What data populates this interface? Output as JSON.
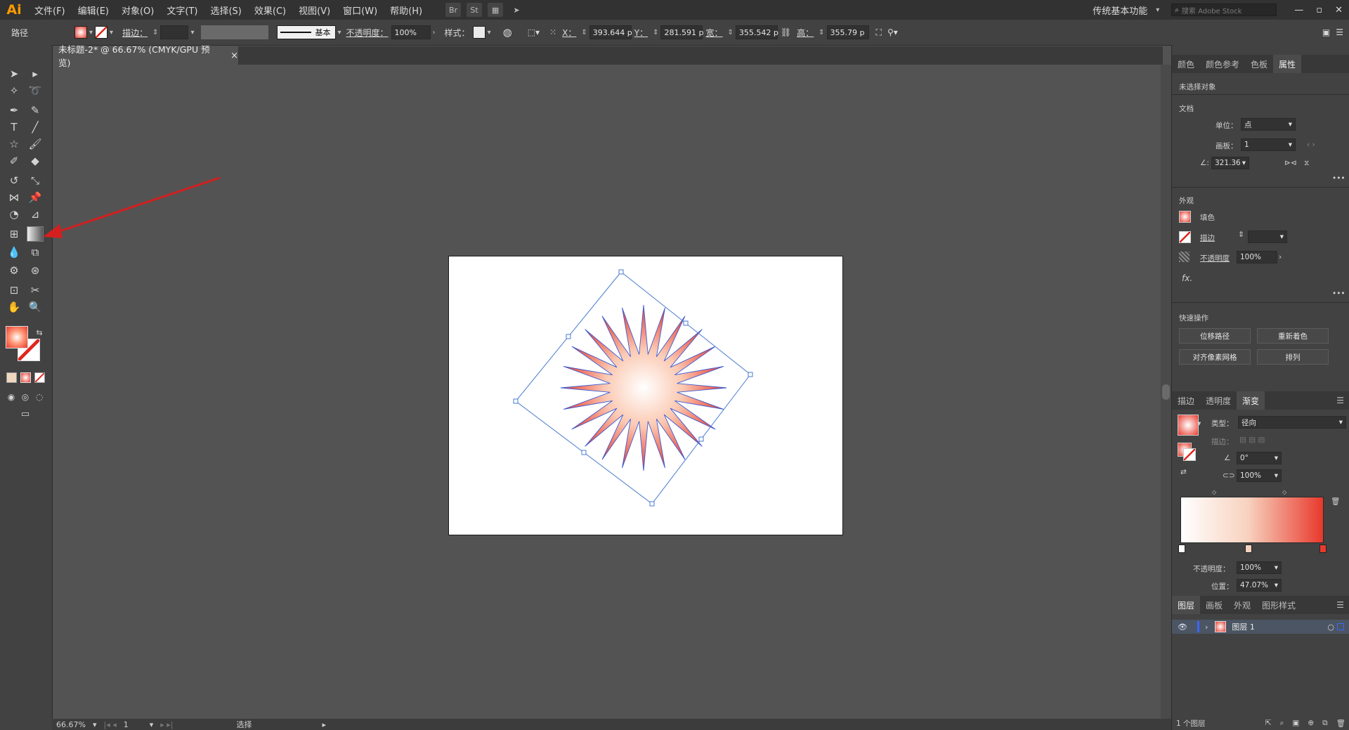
{
  "app": {
    "logo": "Ai",
    "workspace": "传统基本功能",
    "search_placeholder": "搜索 Adobe Stock"
  },
  "menu": [
    "文件(F)",
    "编辑(E)",
    "对象(O)",
    "文字(T)",
    "选择(S)",
    "效果(C)",
    "视图(V)",
    "窗口(W)",
    "帮助(H)"
  ],
  "menubar_icons": {
    "br": "Br",
    "st": "St"
  },
  "control_bar": {
    "object_type": "路径",
    "stroke_label": "描边：",
    "stroke_profile": "基本",
    "opacity_label": "不透明度：",
    "opacity_value": "100%",
    "style_label": "样式：",
    "x_label": "X：",
    "x_value": "393.644 p",
    "y_label": "Y：",
    "y_value": "281.591 p",
    "w_label": "宽：",
    "w_value": "355.542 p",
    "h_label": "高：",
    "h_value": "355.79 p"
  },
  "document_tab": {
    "title": "未标题-2* @ 66.67% (CMYK/GPU 预览)",
    "close": "×"
  },
  "colors": {
    "fill_center": "#ffffff",
    "fill_edge": "#e8392c",
    "stroke_blue": "#3d5bd6",
    "selection": "#4a7bd0"
  },
  "properties_panel": {
    "tabs": [
      "颜色",
      "颜色参考",
      "色板",
      "属性"
    ],
    "no_selection": "未选择对象",
    "document_header": "文档",
    "unit_label": "单位：",
    "unit_value": "点",
    "artboard_label": "画板：",
    "artboard_value": "1",
    "angle_value": "321.36",
    "appearance_header": "外观",
    "fill_label": "填色",
    "stroke_label": "描边",
    "opacity_label": "不透明度",
    "opacity_value": "100%",
    "fx": "fx.",
    "quick_actions_header": "快速操作",
    "quick_actions": [
      "位移路径",
      "重新着色",
      "对齐像素网格",
      "排列"
    ]
  },
  "gradient_panel": {
    "tabs": [
      "描边",
      "透明度",
      "渐变"
    ],
    "type_label": "类型：",
    "type_value": "径向",
    "stroke_label": "描边：",
    "angle_value": "0°",
    "aspect_value": "100%",
    "opacity_label": "不透明度：",
    "opacity_value": "100%",
    "location_label": "位置：",
    "location_value": "47.07%"
  },
  "layers_panel": {
    "tabs": [
      "图层",
      "画板",
      "外观",
      "图形样式"
    ],
    "layer_name": "图层 1",
    "count": "1 个图层"
  },
  "status_bar": {
    "zoom": "66.67%",
    "artboard": "1",
    "tool": "选择"
  }
}
